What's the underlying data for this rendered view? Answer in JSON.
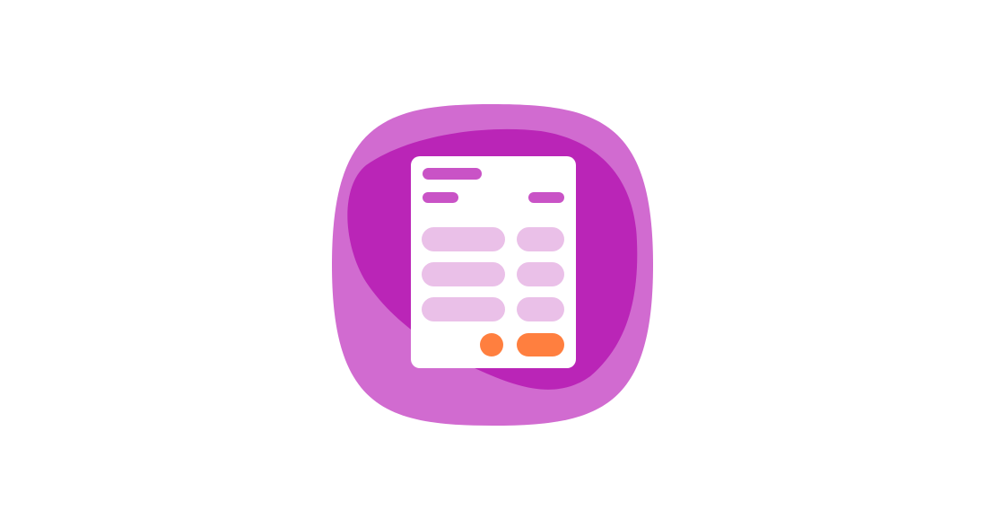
{
  "app_icon": {
    "icon": "invoice-document-icon",
    "colors": {
      "squircle_outer": "#D16BD0",
      "blob_inner": "#BA25B7",
      "document_bg": "#FFFFFF",
      "heading_bar": "#C953C6",
      "line_item_pill": "#EAC0E8",
      "total_accent": "#FF7F3F"
    }
  }
}
